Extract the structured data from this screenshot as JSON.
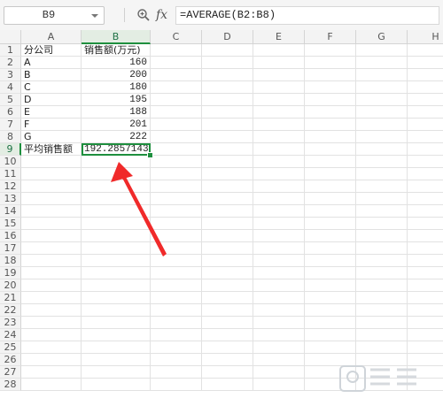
{
  "formula_bar": {
    "name_box": "B9",
    "fx_label": "fx",
    "formula": "=AVERAGE(B2:B8)"
  },
  "columns": [
    "A",
    "B",
    "C",
    "D",
    "E",
    "F",
    "G",
    "H"
  ],
  "rows": [
    "1",
    "2",
    "3",
    "4",
    "5",
    "6",
    "7",
    "8",
    "9",
    "10",
    "11",
    "12",
    "13",
    "14",
    "15",
    "16",
    "17",
    "18",
    "19",
    "20",
    "21",
    "22",
    "23",
    "24",
    "25",
    "26",
    "27",
    "28"
  ],
  "cells": {
    "A1": "分公司",
    "B1": "销售额(万元)",
    "A2": "A",
    "B2": "160",
    "A3": "B",
    "B3": "200",
    "A4": "C",
    "B4": "180",
    "A5": "D",
    "B5": "195",
    "A6": "E",
    "B6": "188",
    "A7": "F",
    "B7": "201",
    "A8": "G",
    "B8": "222",
    "A9": "平均销售额",
    "B9": "192.2857143"
  },
  "selection": {
    "cell": "B9",
    "color": "#1e8f3e"
  },
  "annotation": {
    "arrow_color": "#f02a2a"
  },
  "icons": {
    "zoom": "magnifier-icon",
    "dropdown": "chevron-down-icon",
    "watermark": "watermark-logo"
  }
}
